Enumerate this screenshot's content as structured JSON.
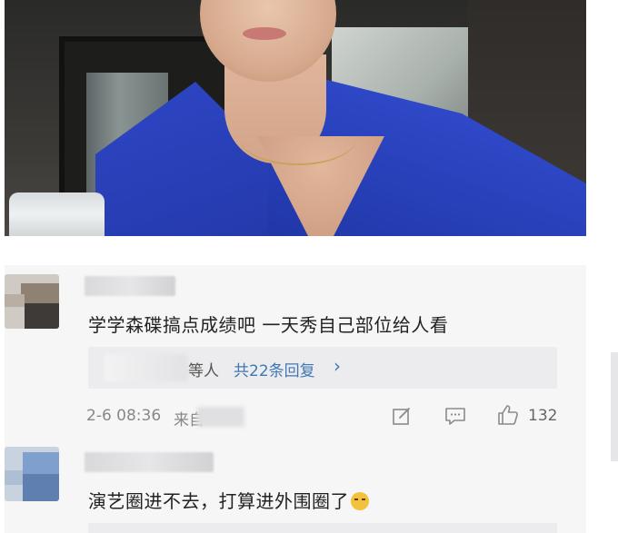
{
  "comments": [
    {
      "text": "学学森碟搞点成绩吧 一天秀自己部位给人看",
      "reply_who": "等人",
      "reply_link": "共22条回复",
      "reply_chevron": "›",
      "date": "2-6 08:36",
      "source_prefix": "来自",
      "likes": "132"
    },
    {
      "text": "演艺圈进不去，打算进外围圈了"
    }
  ],
  "icons": [
    "edit-icon",
    "comment-icon",
    "thumbs-up-icon",
    "smirk-emoji-icon"
  ],
  "colors": {
    "link": "#3f78b4",
    "panel_bg": "#f6f6f7",
    "reply_bg": "#ececee"
  }
}
